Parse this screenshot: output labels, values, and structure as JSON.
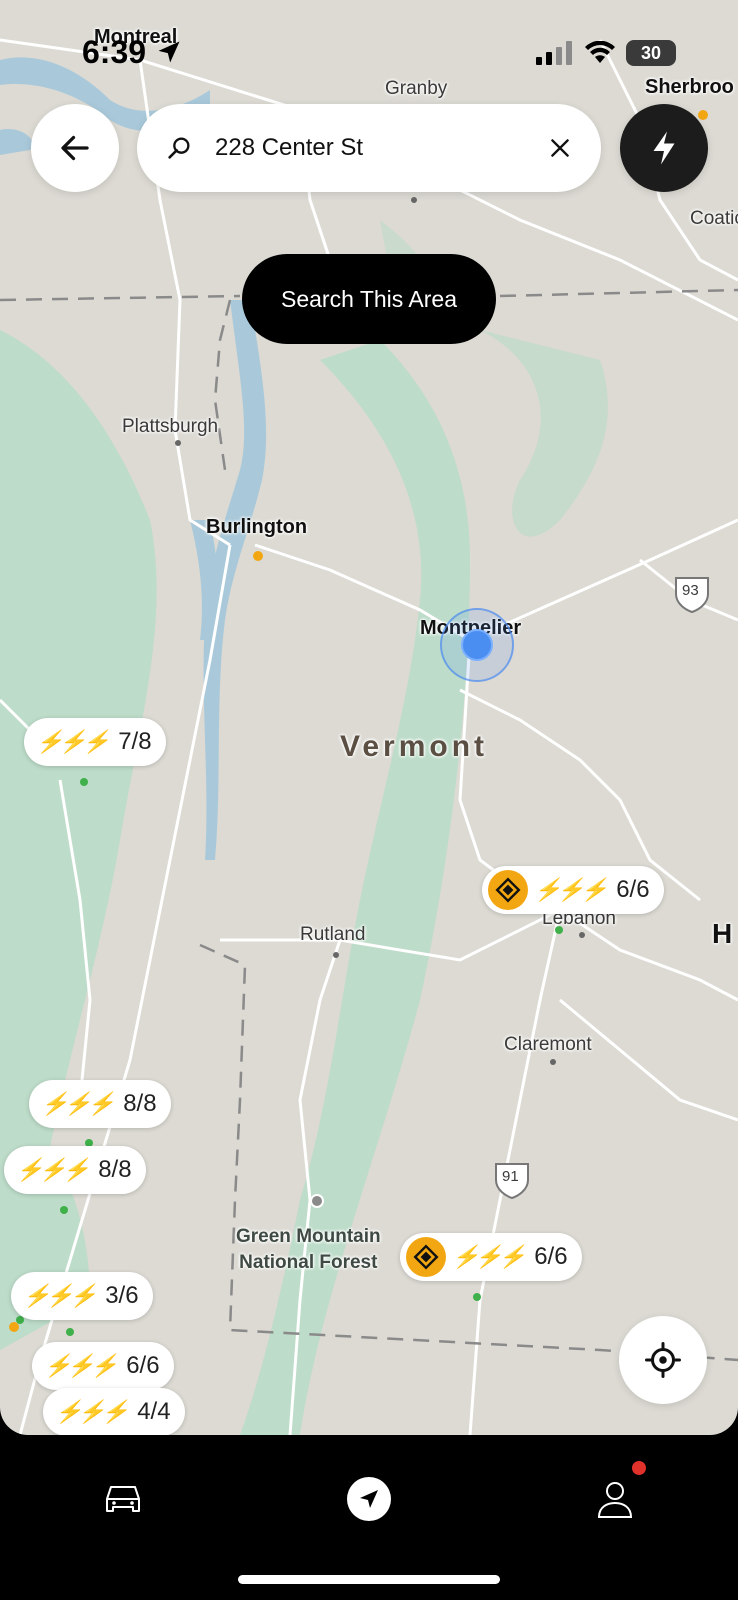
{
  "status_bar": {
    "time": "6:39",
    "battery": "30"
  },
  "search": {
    "query": "228 Center St"
  },
  "search_area_button": "Search This Area",
  "map_labels": {
    "montreal": "Montreal",
    "granby": "Granby",
    "sherbrooke": "Sherbroo",
    "coaticook": "Coatic",
    "plattsburgh": "Plattsburgh",
    "burlington": "Burlington",
    "montpelier": "Montpelier",
    "vermont": "Vermont",
    "rutland": "Rutland",
    "lebanon": "Lebanon",
    "claremont": "Claremont",
    "green_mountain_1": "Green Mountain",
    "green_mountain_2": "National Forest",
    "h_partial": "H",
    "route_93": "93",
    "route_91": "91"
  },
  "chargers": [
    {
      "count": "7/8",
      "network": false
    },
    {
      "count": "6/6",
      "network": true
    },
    {
      "count": "8/8",
      "network": false
    },
    {
      "count": "8/8",
      "network": false
    },
    {
      "count": "6/6",
      "network": true
    },
    {
      "count": "3/6",
      "network": false
    },
    {
      "count": "6/6",
      "network": false
    },
    {
      "count": "4/4",
      "network": false
    }
  ],
  "colors": {
    "map_land": "#dcdad3",
    "map_forest": "#b7dcc8",
    "water": "#a9c9da",
    "charger_green": "#6dcf3b",
    "network_orange": "#f2a712",
    "location_blue": "#4b8ef1",
    "notification_red": "#e0312b"
  },
  "icons": [
    "back-arrow-icon",
    "search-icon",
    "clear-icon",
    "lightning-icon",
    "locate-icon",
    "car-icon",
    "navigation-arrow-icon",
    "profile-icon"
  ]
}
